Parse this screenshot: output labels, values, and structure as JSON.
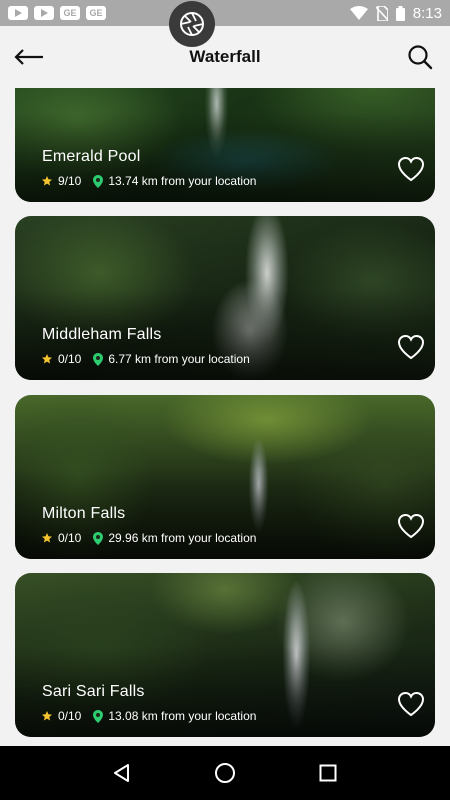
{
  "status_bar": {
    "time": "8:13",
    "icons": [
      "youtube-icon",
      "youtube-icon",
      "ge-icon",
      "ge-icon",
      "wifi-icon",
      "no-sim-icon",
      "battery-icon"
    ],
    "ge_label": "GE"
  },
  "header": {
    "title": "Waterfall",
    "back_icon": "arrow-left-icon",
    "search_icon": "search-icon"
  },
  "waterfalls": [
    {
      "name": "Emerald Pool",
      "rating": "9/10",
      "distance": "13.74 km from your location"
    },
    {
      "name": "Middleham Falls",
      "rating": "0/10",
      "distance": "6.77 km from your location"
    },
    {
      "name": "Milton Falls",
      "rating": "0/10",
      "distance": "29.96 km from your location"
    },
    {
      "name": "Sari Sari Falls",
      "rating": "0/10",
      "distance": "13.08 km from your location"
    }
  ],
  "colors": {
    "star": "#f4c430",
    "pin": "#2ecc71",
    "background": "#f2f2f2"
  },
  "nav": [
    "back-nav-icon",
    "home-nav-icon",
    "recents-nav-icon"
  ]
}
